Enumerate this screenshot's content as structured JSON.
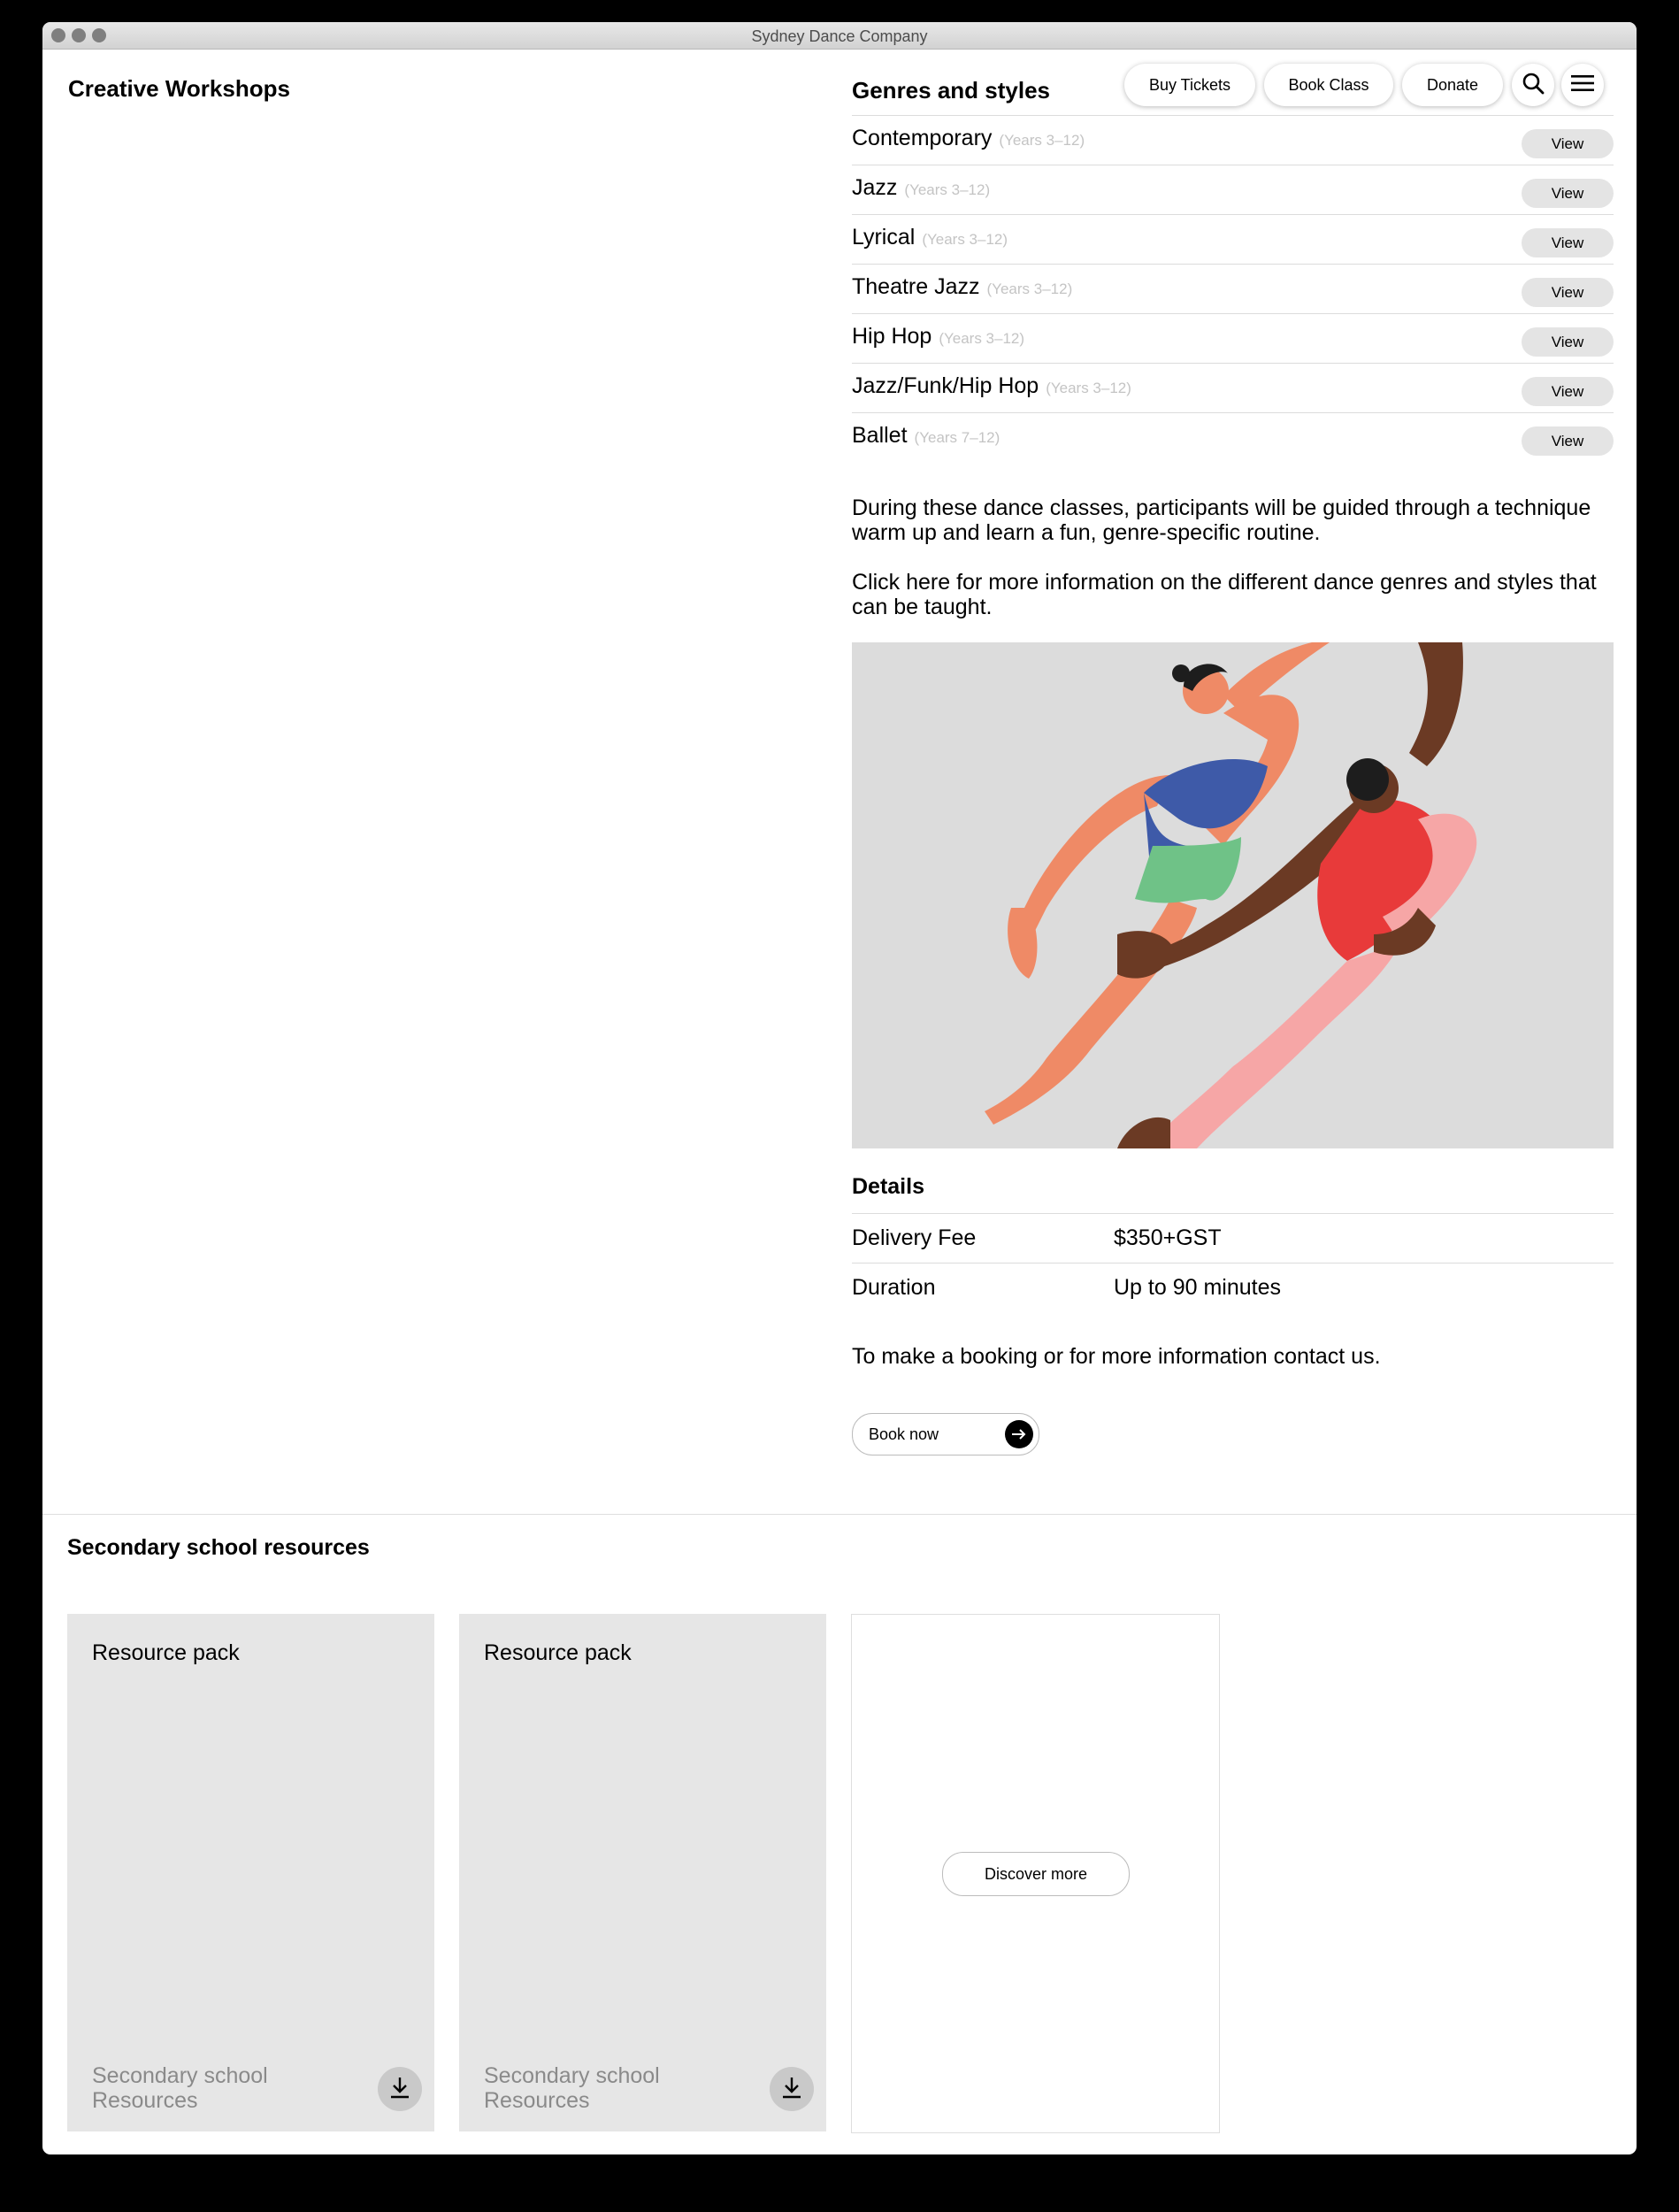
{
  "window": {
    "title": "Sydney Dance Company"
  },
  "page": {
    "title": "Creative Workshops"
  },
  "nav": {
    "buy_tickets": "Buy Tickets",
    "book_class": "Book Class",
    "donate": "Donate",
    "search_icon": "search-icon",
    "menu_icon": "menu-icon"
  },
  "genres": {
    "title": "Genres and styles",
    "view_label": "View",
    "items": [
      {
        "name": "Contemporary",
        "years": "(Years 3–12)"
      },
      {
        "name": "Jazz",
        "years": "(Years 3–12)"
      },
      {
        "name": "Lyrical",
        "years": "(Years 3–12)"
      },
      {
        "name": "Theatre Jazz",
        "years": "(Years 3–12)"
      },
      {
        "name": "Hip Hop",
        "years": "(Years 3–12)"
      },
      {
        "name": "Jazz/Funk/Hip Hop",
        "years": "(Years 3–12)"
      },
      {
        "name": "Ballet",
        "years": "(Years 7–12)"
      }
    ]
  },
  "description": {
    "p1": "During these dance classes, participants will be guided through a technique warm up and learn a fun, genre-specific routine.",
    "p2": "Click here for more information on the different dance genres and styles that can be taught."
  },
  "details": {
    "title": "Details",
    "rows": [
      {
        "label": "Delivery Fee",
        "value": "$350+GST"
      },
      {
        "label": "Duration",
        "value": "Up to 90 minutes"
      }
    ],
    "contact": "To make a booking or for more information contact us.",
    "book_now": "Book now"
  },
  "secondary": {
    "title": "Secondary school resources",
    "cards": [
      {
        "title": "Resource pack",
        "subtitle_line1": "Secondary school",
        "subtitle_line2": "Resources"
      },
      {
        "title": "Resource pack",
        "subtitle_line1": "Secondary school",
        "subtitle_line2": "Resources"
      }
    ],
    "discover_more": "Discover more"
  },
  "colors": {
    "background": "#000000",
    "card_gray": "#e6e6e6",
    "illustration_bg": "#dcdcdc",
    "muted_text": "#8a8a8a"
  }
}
